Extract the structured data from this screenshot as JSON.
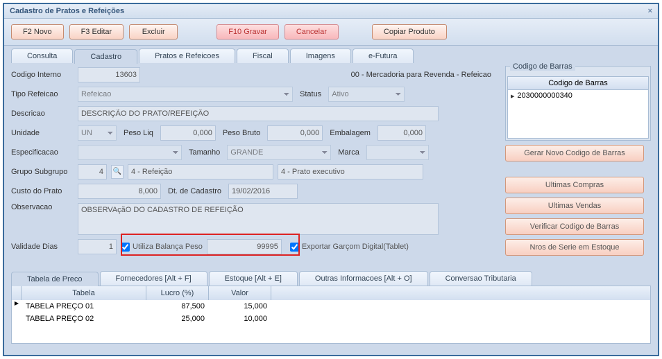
{
  "title": "Cadastro de Pratos e Refeições",
  "toolbar": {
    "novo": "F2 Novo",
    "editar": "F3 Editar",
    "excluir": "Excluir",
    "gravar": "F10 Gravar",
    "cancelar": "Cancelar",
    "copiar": "Copiar Produto"
  },
  "tabs": {
    "consulta": "Consulta",
    "cadastro": "Cadastro",
    "pratos": "Pratos e Refeicoes",
    "fiscal": "Fiscal",
    "imagens": "Imagens",
    "efutura": "e-Futura"
  },
  "labels": {
    "codigo_interno": "Codigo Interno",
    "tipo_refeicao": "Tipo Refeicao",
    "descricao": "Descricao",
    "unidade": "Unidade",
    "peso_liq": "Peso Liq",
    "peso_bruto": "Peso Bruto",
    "embalagem": "Embalagem",
    "especificacao": "Especificacao",
    "tamanho": "Tamanho",
    "marca": "Marca",
    "grupo_subgrupo": "Grupo Subgrupo",
    "custo_prato": "Custo do Prato",
    "dt_cadastro": "Dt. de Cadastro",
    "observacao": "Observacao",
    "validade_dias": "Validade Dias",
    "status": "Status",
    "utiliza_balanca": "Utiliza Balança Peso",
    "exportar_garcom": "Exportar Garçom Digital(Tablet)"
  },
  "values": {
    "codigo_interno": "13603",
    "revenda_text": "00 - Mercadoria para Revenda - Refeicao",
    "tipo_refeicao": "Refeicao",
    "status": "Ativo",
    "descricao": "DESCRIÇÃO DO PRATO/REFEIÇÃO",
    "unidade": "UN",
    "peso_liq": "0,000",
    "peso_bruto": "0,000",
    "embalagem": "0,000",
    "tamanho": "GRANDE",
    "grupo_num": "4",
    "grupo_desc": "4 - Refeição",
    "subgrupo_desc": "4 - Prato executivo",
    "custo_prato": "8,000",
    "dt_cadastro": "19/02/2016",
    "observacao": "OBSERVAçãO DO CADASTRO DE REFEIÇÃO",
    "validade_dias": "1",
    "balanca_val": "99995"
  },
  "barcode_panel": {
    "title": "Codigo de Barras",
    "col": "Codigo de Barras",
    "row0": "2030000000340",
    "btn": "Gerar Novo Codigo de Barras"
  },
  "action_buttons": {
    "compras": "Ultimas Compras",
    "vendas": "Ultimas Vendas",
    "verificar": "Verificar Codigo de Barras",
    "serie": "Nros de Serie em Estoque"
  },
  "sub_tabs": {
    "tabela_preco": "Tabela de Preco",
    "fornecedores": "Fornecedores [Alt + F]",
    "estoque": "Estoque [Alt + E]",
    "outras": "Outras Informacoes [Alt + O]",
    "conversao": "Conversao Tributaria"
  },
  "grid": {
    "col_tabela": "Tabela",
    "col_lucro": "Lucro (%)",
    "col_valor": "Valor",
    "rows": [
      {
        "tabela": "TABELA PREÇO 01",
        "lucro": "87,500",
        "valor": "15,000"
      },
      {
        "tabela": "TABELA PREÇO 02",
        "lucro": "25,000",
        "valor": "10,000"
      }
    ]
  }
}
